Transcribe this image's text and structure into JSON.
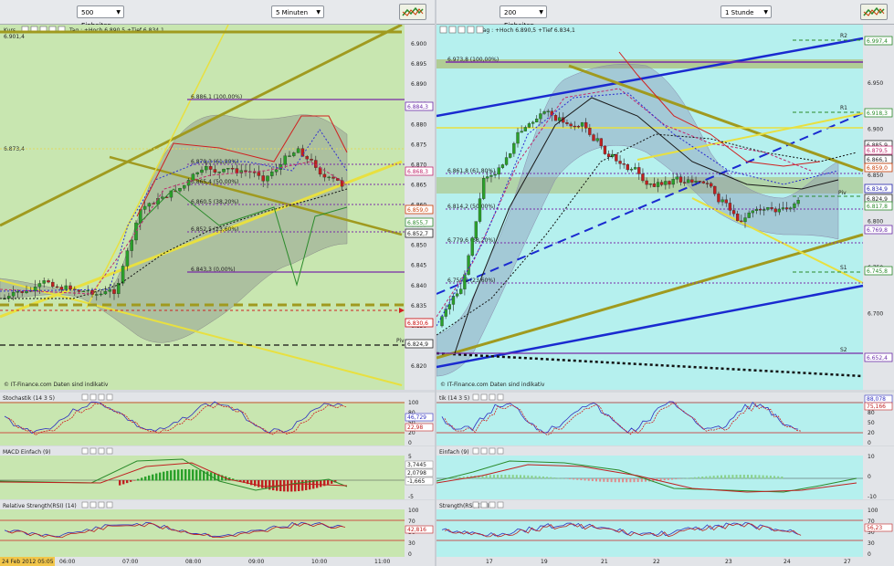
{
  "left": {
    "toolbar": {
      "units_select": "500 Einheiten",
      "interval_select": "5 Minuten"
    },
    "main_header": "Kurs",
    "info_line": "Tag : +Hoch 6.890,5 +Tief 6.834,1",
    "top_left_value": "6.901,4",
    "left_value_1": "6.873,4",
    "watermark": "© IT-Finance.com  Daten sind indikativ",
    "y_ticks": [
      "6.900",
      "6.895",
      "6.890",
      "6.885",
      "6.880",
      "6.875",
      "6.870",
      "6.865",
      "6.860",
      "6.855",
      "6.850",
      "6.845",
      "6.840",
      "6.835",
      "6.830",
      "6.825",
      "6.820"
    ],
    "x_ticks": [
      "06:00",
      "07:00",
      "08:00",
      "09:00",
      "10:00",
      "11:00"
    ],
    "date_badge": "24 Feb 2012 05:05",
    "fib_labels": [
      "6.886,1 (100,00%)",
      "6.870,3 (61,80%)",
      "6.865,4 (50,00%)",
      "6.860,5 (38,20%)",
      "6.852,5 (23,60%)",
      "6.843,3 (0,00%)"
    ],
    "price_tags": [
      {
        "text": "6.884,3",
        "color": "#6b2aa8"
      },
      {
        "text": "6.868,3",
        "color": "#c0286e"
      },
      {
        "text": "6.859,0",
        "color": "#c83a00"
      },
      {
        "text": "6.855,7",
        "color": "#2a8a2a"
      },
      {
        "text": "6.852,7",
        "color": "#222222"
      },
      {
        "text": "6.830,6",
        "color": "#c80000"
      },
      {
        "text": "6.824,9",
        "color": "#222222"
      }
    ],
    "pivot_tag": "Piv",
    "stoch": {
      "title": "Stochastik (14 3 5)",
      "ticks": [
        "100",
        "80",
        "50",
        "20",
        "0"
      ],
      "values": [
        "46,729",
        "22,98"
      ]
    },
    "macd": {
      "title": "MACD Einfach (9)",
      "values": [
        "3,7445",
        "2,0798",
        "-1,665"
      ],
      "ticks": [
        "5",
        "0",
        "-5"
      ]
    },
    "rsi": {
      "title": "Relative Strength(RSI) (14)",
      "values": [
        "42,816"
      ],
      "ticks": [
        "100",
        "70",
        "50",
        "30",
        "0"
      ]
    }
  },
  "right": {
    "toolbar": {
      "units_select": "200 Einheiten",
      "interval_select": "1 Stunde"
    },
    "info_line": "Tag : +Hoch 6.890,5 +Tief 6.834,1",
    "watermark": "© IT-Finance.com  Daten sind indikativ",
    "y_ticks": [
      "6.950",
      "6.900",
      "6.850",
      "6.800",
      "6.750",
      "6.700",
      "6.650"
    ],
    "x_ticks": [
      "17",
      "19",
      "21",
      "22",
      "23",
      "24",
      "27"
    ],
    "fib_labels": [
      "6.973,8 (100,00%)",
      "6.861,8 (61,80%)",
      "6.814,2 (50,00%)",
      "6.779,6 (38,20%)",
      "6.750,8 (23,60%)"
    ],
    "pivot_labels": [
      "R2",
      "R1",
      "Piv",
      "S1",
      "S2"
    ],
    "price_tags": [
      {
        "text": "6.997,4",
        "color": "#2a8a2a"
      },
      {
        "text": "6.918,3",
        "color": "#2a8a2a"
      },
      {
        "text": "6.885,9",
        "color": "#222222"
      },
      {
        "text": "6.879,5",
        "color": "#c0286e"
      },
      {
        "text": "6.866,1",
        "color": "#222222"
      },
      {
        "text": "6.859,0",
        "color": "#c83a00"
      },
      {
        "text": "6.834,9",
        "color": "#2222aa"
      },
      {
        "text": "6.824,9",
        "color": "#222222"
      },
      {
        "text": "6.817,8",
        "color": "#2a8a2a"
      },
      {
        "text": "6.769,8",
        "color": "#6b2aa8"
      },
      {
        "text": "6.745,8",
        "color": "#2a8a2a"
      },
      {
        "text": "6.652,4",
        "color": "#6b2aa8"
      }
    ],
    "stoch": {
      "title": "tik (14 3 5)",
      "ticks": [
        "100",
        "80",
        "50",
        "20",
        "0"
      ],
      "values": [
        "88,078",
        "75,166"
      ]
    },
    "macd": {
      "title": "Einfach (9)",
      "ticks": [
        "10",
        "0",
        "-10"
      ]
    },
    "rsi": {
      "title": "Strength(RSI) (14)",
      "values": [
        "56,23"
      ],
      "ticks": [
        "100",
        "70",
        "50",
        "30",
        "0"
      ]
    }
  },
  "colors": {
    "left_bg": "#c8e6b0",
    "right_bg": "#b5f0ee",
    "olive": "#a09a1f",
    "yellow": "#e8e040",
    "purple": "#7a2aa8",
    "blue": "#1a2ad0",
    "red": "#d02020"
  }
}
